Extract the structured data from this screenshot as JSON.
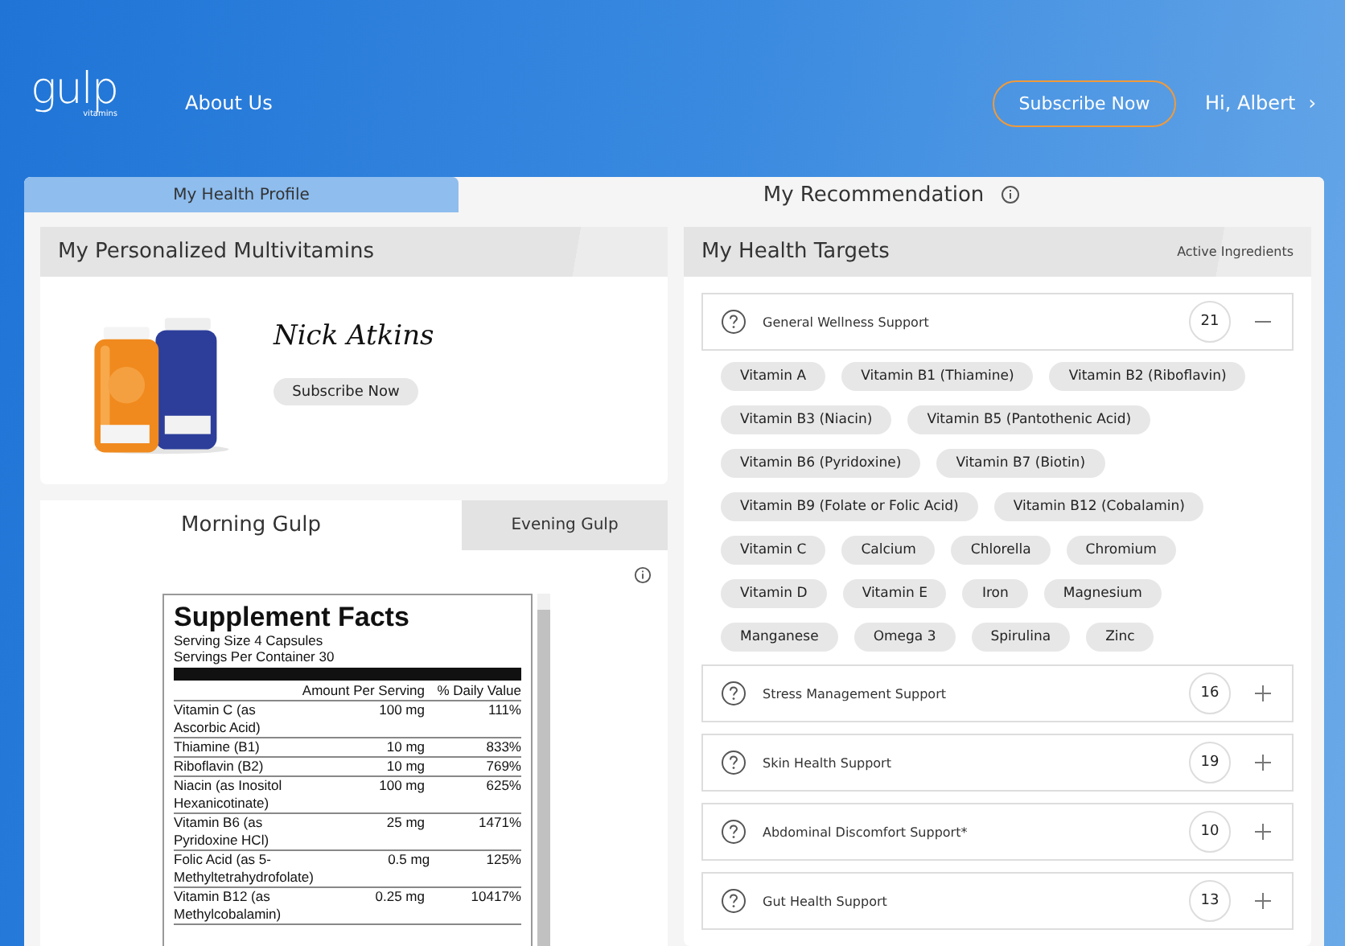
{
  "header": {
    "logo": "gulp",
    "logo_sub": "vitamins",
    "nav": [
      "About Us"
    ],
    "subscribe": "Subscribe Now",
    "user": "Hi, Albert",
    "user_chevron": "›"
  },
  "tabs": [
    {
      "label": "My Health Profile",
      "selected": false
    },
    {
      "label": "My Recommendation",
      "selected": true
    }
  ],
  "multivitamins": {
    "title": "My Personalized Multivitamins",
    "signature": "Nick Atkins",
    "button": "Subscribe Now"
  },
  "gulp_tabs": [
    {
      "label": "Morning Gulp",
      "selected": true
    },
    {
      "label": "Evening Gulp",
      "selected": false
    }
  ],
  "supplement_facts": {
    "title": "Supplement Facts",
    "serving_size": "Serving Size 4 Capsules",
    "servings": "Servings Per Container 30",
    "col_amount": "Amount Per Serving",
    "col_dv": "% Daily Value",
    "rows": [
      {
        "name": "Vitamin C (as Ascorbic Acid)",
        "amount": "100 mg",
        "dv": "111%"
      },
      {
        "name": "Thiamine (B1)",
        "amount": "10 mg",
        "dv": "833%"
      },
      {
        "name": "Riboflavin (B2)",
        "amount": "10 mg",
        "dv": "769%"
      },
      {
        "name": "Niacin (as Inositol Hexanicotinate)",
        "amount": "100 mg",
        "dv": "625%"
      },
      {
        "name": "Vitamin B6 (as Pyridoxine HCl)",
        "amount": "25 mg",
        "dv": "1471%"
      },
      {
        "name": "Folic Acid (as 5-Methyltetrahydrofolate)",
        "amount": "0.5 mg",
        "dv": "125%"
      },
      {
        "name": "Vitamin B12 (as Methylcobalamin)",
        "amount": "0.25 mg",
        "dv": "10417%"
      }
    ]
  },
  "health_targets": {
    "title": "My Health Targets",
    "side_label": "Active Ingredients",
    "items": [
      {
        "name": "General Wellness Support",
        "count": "21",
        "expanded": true,
        "ingredients": [
          "Vitamin A",
          "Vitamin B1 (Thiamine)",
          "Vitamin B2 (Riboflavin)",
          "Vitamin B3 (Niacin)",
          "Vitamin B5 (Pantothenic Acid)",
          "Vitamin B6 (Pyridoxine)",
          "Vitamin B7 (Biotin)",
          "Vitamin B9 (Folate or Folic Acid)",
          "Vitamin B12 (Cobalamin)",
          "Vitamin C",
          "Calcium",
          "Chlorella",
          "Chromium",
          "Vitamin D",
          "Vitamin E",
          "Iron",
          "Magnesium",
          "Manganese",
          "Omega 3",
          "Spirulina",
          "Zinc"
        ]
      },
      {
        "name": "Stress Management Support",
        "count": "16",
        "expanded": false
      },
      {
        "name": "Skin Health Support",
        "count": "19",
        "expanded": false
      },
      {
        "name": "Abdominal Discomfort Support*",
        "count": "10",
        "expanded": false
      },
      {
        "name": "Gut Health Support",
        "count": "13",
        "expanded": false
      }
    ]
  }
}
